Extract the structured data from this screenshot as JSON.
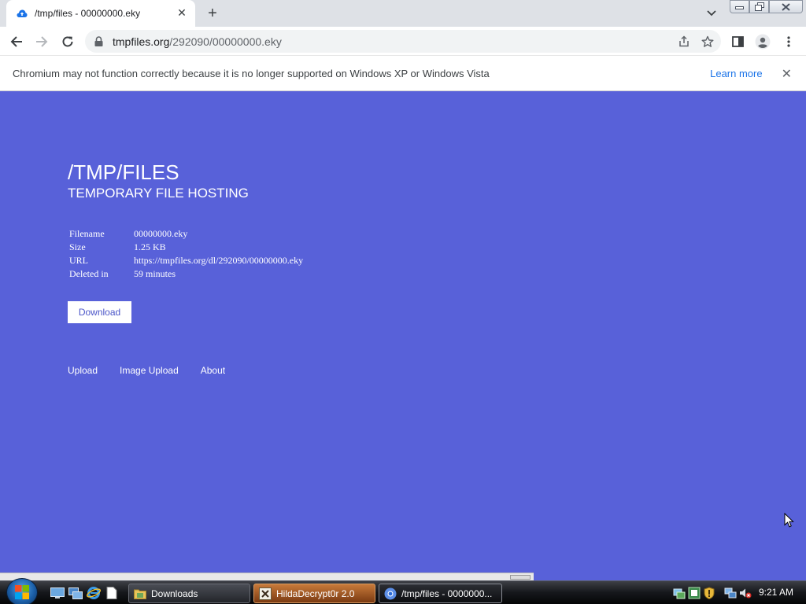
{
  "browser": {
    "tab_title": "/tmp/files - 00000000.eky",
    "tab_close": "✕",
    "new_tab": "+",
    "url_host": "tmpfiles.org",
    "url_path": "/292090/00000000.eky"
  },
  "infobar": {
    "message": "Chromium may not function correctly because it is no longer supported on Windows XP or Windows Vista",
    "learn_more": "Learn more",
    "close": "✕"
  },
  "page": {
    "title": "/TMP/FILES",
    "subtitle": "TEMPORARY FILE HOSTING",
    "info": [
      {
        "key": "Filename",
        "value": "00000000.eky"
      },
      {
        "key": "Size",
        "value": "1.25 KB"
      },
      {
        "key": "URL",
        "value": "https://tmpfiles.org/dl/292090/00000000.eky"
      },
      {
        "key": "Deleted in",
        "value": "59 minutes"
      }
    ],
    "download_label": "Download",
    "links": [
      "Upload",
      "Image Upload",
      "About"
    ]
  },
  "taskbar": {
    "tasks": [
      "Downloads",
      "HildaDecrypt0r 2.0",
      "/tmp/files - 0000000..."
    ],
    "clock": "9:21 AM"
  },
  "colors": {
    "page_bg": "#5861d9",
    "link_blue": "#1a73e8",
    "button_text": "#4b55c8"
  }
}
